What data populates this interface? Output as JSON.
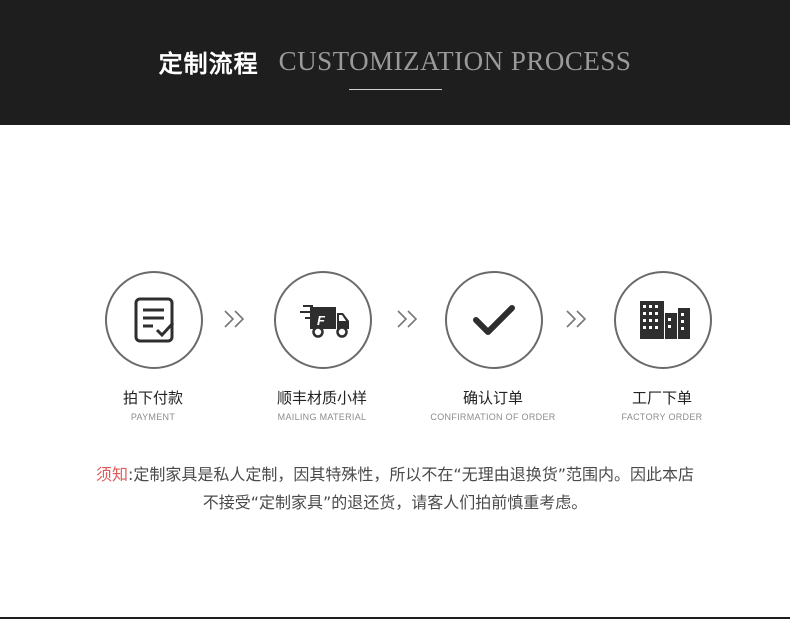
{
  "header": {
    "title_cn": "定制流程",
    "title_en": "CUSTOMIZATION PROCESS"
  },
  "steps": [
    {
      "icon": "document-check-icon",
      "label_cn": "拍下付款",
      "label_en": "PAYMENT"
    },
    {
      "icon": "delivery-truck-icon",
      "label_cn": "顺丰材质小样",
      "label_en": "MAILING MATERIAL"
    },
    {
      "icon": "checkmark-icon",
      "label_cn": "确认订单",
      "label_en": "CONFIRMATION OF ORDER"
    },
    {
      "icon": "factory-building-icon",
      "label_cn": "工厂下单",
      "label_en": "FACTORY ORDER"
    }
  ],
  "notice": {
    "label": "须知",
    "line1": ":定制家具是私人定制，因其特殊性，所以不在“无理由退换货”范围内。因此本店",
    "line2": "不接受“定制家具”的退还货，请客人们拍前慎重考虑。"
  },
  "colors": {
    "header_bg": "#1e1e1e",
    "notice_label": "#e05a5a",
    "icon": "#2e2e2e"
  }
}
